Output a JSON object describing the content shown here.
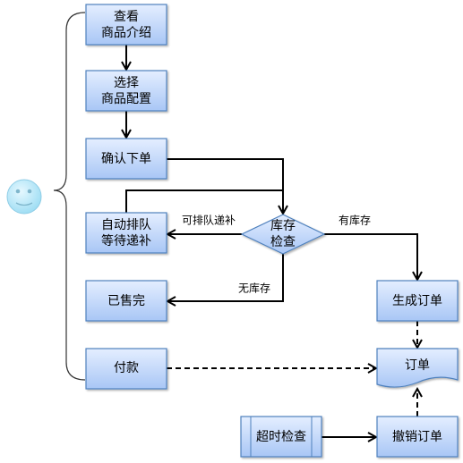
{
  "nodes": {
    "view": [
      "查看",
      "商品介绍"
    ],
    "select": [
      "选择",
      "商品配置"
    ],
    "confirm": "确认下单",
    "queue": [
      "自动排队",
      "等待递补"
    ],
    "soldout": "已售完",
    "pay": "付款",
    "stock": [
      "库存",
      "检查"
    ],
    "generate": "生成订单",
    "order": "订单",
    "cancel": "撤销订单",
    "timeout": "超时检查"
  },
  "edges": {
    "queue_label": "可排队递补",
    "none_label": "无库存",
    "have_label": "有库存"
  },
  "colors": {
    "box_top": "#e4eeff",
    "box_bottom": "#a8c6f5",
    "border": "#4f81bd",
    "smiley": "#aee4f7"
  },
  "icons": {
    "user": "smiley-face-icon"
  }
}
